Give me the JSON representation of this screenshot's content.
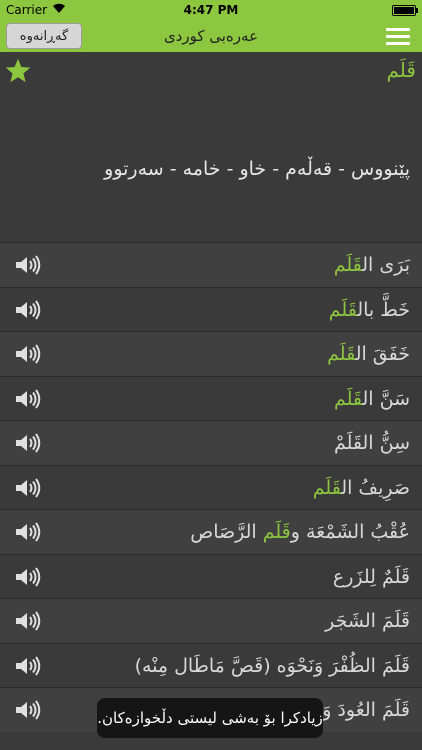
{
  "status_bar": {
    "carrier": "Carrier",
    "time": "4:47 PM"
  },
  "nav": {
    "back_label": "گەڕانەوە",
    "title": "عەرەبی كوردی",
    "menu_icon": "hamburger-menu-icon"
  },
  "entry": {
    "word": "قَلَم",
    "meaning": "پێنووس - قەڵەم - خاو - خامە - سەرتوو",
    "favorite_icon": "star-icon"
  },
  "list": [
    {
      "before": "بَرَى ال",
      "highlight": "قَلَم",
      "after": ""
    },
    {
      "before": "خَطَّ بال",
      "highlight": "قَلَم",
      "after": ""
    },
    {
      "before": "خَفَقَ ال",
      "highlight": "قَلَم",
      "after": ""
    },
    {
      "before": "سَنَّ ال",
      "highlight": "قَلَم",
      "after": ""
    },
    {
      "before": "سِنُّ القَلَمْ",
      "highlight": "",
      "after": ""
    },
    {
      "before": "صَرِيفُ ال",
      "highlight": "قَلَم",
      "after": ""
    },
    {
      "before": "عُقْبُ الشَمْعَة و",
      "highlight": "قَلَم",
      "after": " الرَّصَاص"
    },
    {
      "before": "قَلَمٌ لِلزَرع",
      "highlight": "",
      "after": ""
    },
    {
      "before": "قَلَمَ الشَجَر",
      "highlight": "",
      "after": ""
    },
    {
      "before": "قَلَمَ الظُفْرَ وَنَحْوَه (قَصَّ مَاطَال مِنْه)",
      "highlight": "",
      "after": ""
    },
    {
      "before": "قَلَمَ العُودَ وَنَحْوَه (بَرَاه)",
      "highlight": "",
      "after": ""
    }
  ],
  "toast": {
    "message": "زیادکرا بۆ بەشی لیستی دڵخوازەکان."
  },
  "colors": {
    "accent": "#8dc63f",
    "background": "#3a3a3a",
    "row_alt": "#404040",
    "toast_bg": "#151515"
  }
}
